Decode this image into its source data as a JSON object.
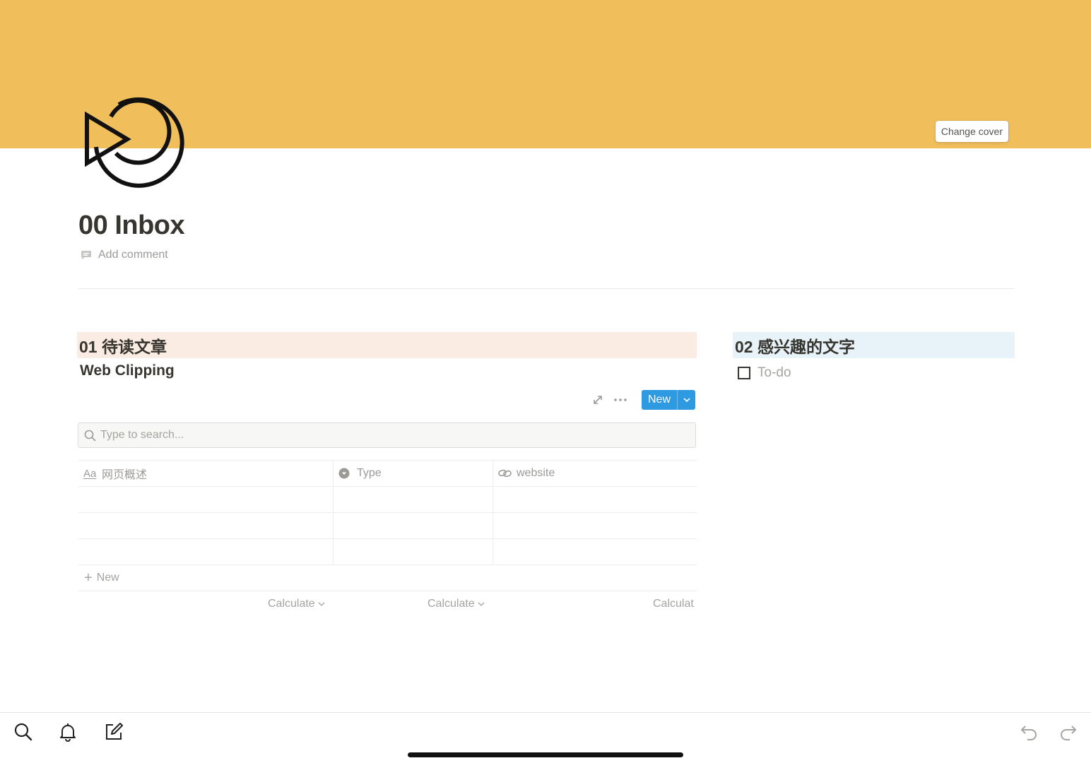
{
  "cover": {
    "color": "#f1be5c",
    "change_cover_label": "Change cover"
  },
  "page": {
    "icon": "replay-play-icon",
    "title": "00 Inbox",
    "add_comment_label": "Add comment"
  },
  "left_column": {
    "heading": "01 待读文章",
    "heading_bg": "#fbece3",
    "database": {
      "title": "Web Clipping",
      "toolbar": {
        "expand_icon": "expand-icon",
        "more_icon": "more-icon",
        "new_label": "New",
        "accent": "#2e9ae2"
      },
      "search": {
        "placeholder": "Type to search..."
      },
      "columns": [
        {
          "icon": "Aa",
          "label": "网页概述"
        },
        {
          "icon": "select-icon",
          "label": "Type"
        },
        {
          "icon": "link-icon",
          "label": "website"
        }
      ],
      "rows": [
        [
          "",
          "",
          ""
        ],
        [
          "",
          "",
          ""
        ],
        [
          "",
          "",
          ""
        ]
      ],
      "new_row_label": "New",
      "calculate_labels": [
        "Calculate",
        "Calculate",
        "Calculat"
      ]
    }
  },
  "right_column": {
    "heading": "02 感兴趣的文字",
    "heading_bg": "#e7f3f8",
    "todo": {
      "label": "To-do",
      "checked": false
    }
  },
  "bottom_bar": {
    "left_icons": [
      "search-icon",
      "bell-icon",
      "compose-icon"
    ],
    "right_icons": [
      "undo-icon",
      "redo-icon"
    ]
  }
}
